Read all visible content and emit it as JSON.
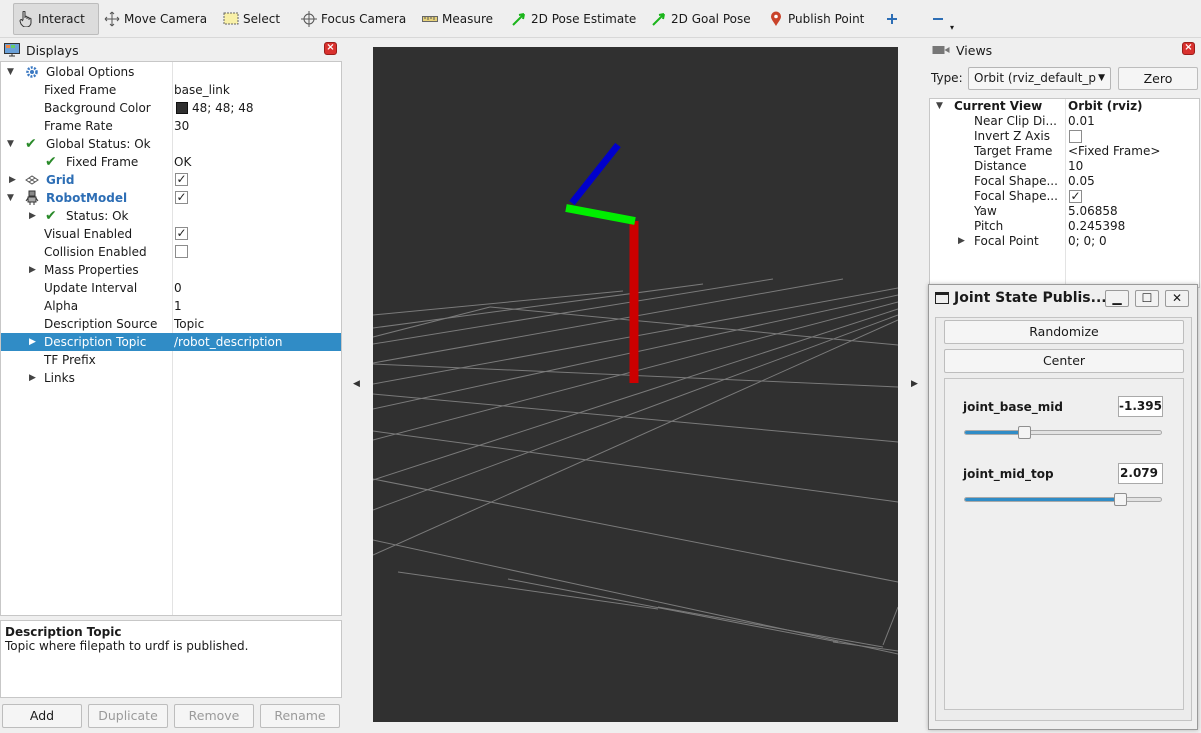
{
  "toolbar": {
    "interact": "Interact",
    "move_camera": "Move Camera",
    "select": "Select",
    "focus_camera": "Focus Camera",
    "measure": "Measure",
    "pose_estimate": "2D Pose Estimate",
    "goal_pose": "2D Goal Pose",
    "publish_point": "Publish Point"
  },
  "displays": {
    "title": "Displays",
    "global_options": "Global Options",
    "fixed_frame_label": "Fixed Frame",
    "fixed_frame_value": "base_link",
    "bg_color_label": "Background Color",
    "bg_color_value": "48; 48; 48",
    "frame_rate_label": "Frame Rate",
    "frame_rate_value": "30",
    "global_status": "Global Status: Ok",
    "gs_fixed_frame": "Fixed Frame",
    "gs_fixed_frame_value": "OK",
    "grid": "Grid",
    "robot_model": "RobotModel",
    "status_ok": "Status: Ok",
    "visual_enabled": "Visual Enabled",
    "collision_enabled": "Collision Enabled",
    "mass_properties": "Mass Properties",
    "update_interval": "Update Interval",
    "update_interval_value": "0",
    "alpha": "Alpha",
    "alpha_value": "1",
    "description_source": "Description Source",
    "description_source_value": "Topic",
    "description_topic": "Description Topic",
    "description_topic_value": "/robot_description",
    "tf_prefix": "TF Prefix",
    "links": "Links"
  },
  "description": {
    "title": "Description Topic",
    "text": "Topic where filepath to urdf is published."
  },
  "buttons": {
    "add": "Add",
    "duplicate": "Duplicate",
    "remove": "Remove",
    "rename": "Rename"
  },
  "views": {
    "title": "Views",
    "type_label": "Type:",
    "type_value": "Orbit (rviz_default_p",
    "zero": "Zero",
    "current_view": "Current View",
    "current_view_value": "Orbit (rviz)",
    "near_clip": "Near Clip Di...",
    "near_clip_value": "0.01",
    "invert_z": "Invert Z Axis",
    "target_frame": "Target Frame",
    "target_frame_value": "<Fixed Frame>",
    "distance": "Distance",
    "distance_value": "10",
    "focal_shape_1": "Focal Shape...",
    "focal_shape_1_value": "0.05",
    "focal_shape_2": "Focal Shape...",
    "yaw": "Yaw",
    "yaw_value": "5.06858",
    "pitch": "Pitch",
    "pitch_value": "0.245398",
    "focal_point": "Focal Point",
    "focal_point_value": "0; 0; 0"
  },
  "jsp": {
    "title": "Joint State Publis...",
    "randomize": "Randomize",
    "center": "Center",
    "joints": [
      {
        "name": "joint_base_mid",
        "value": "-1.395",
        "fraction": 0.29
      },
      {
        "name": "joint_mid_top",
        "value": "2.079",
        "fraction": 0.81
      }
    ]
  },
  "colors": {
    "accent": "#308cc6",
    "viewport_bg": "#303030",
    "link_red": "#cc0000",
    "link_green": "#00ee00",
    "link_blue": "#0000cc"
  }
}
